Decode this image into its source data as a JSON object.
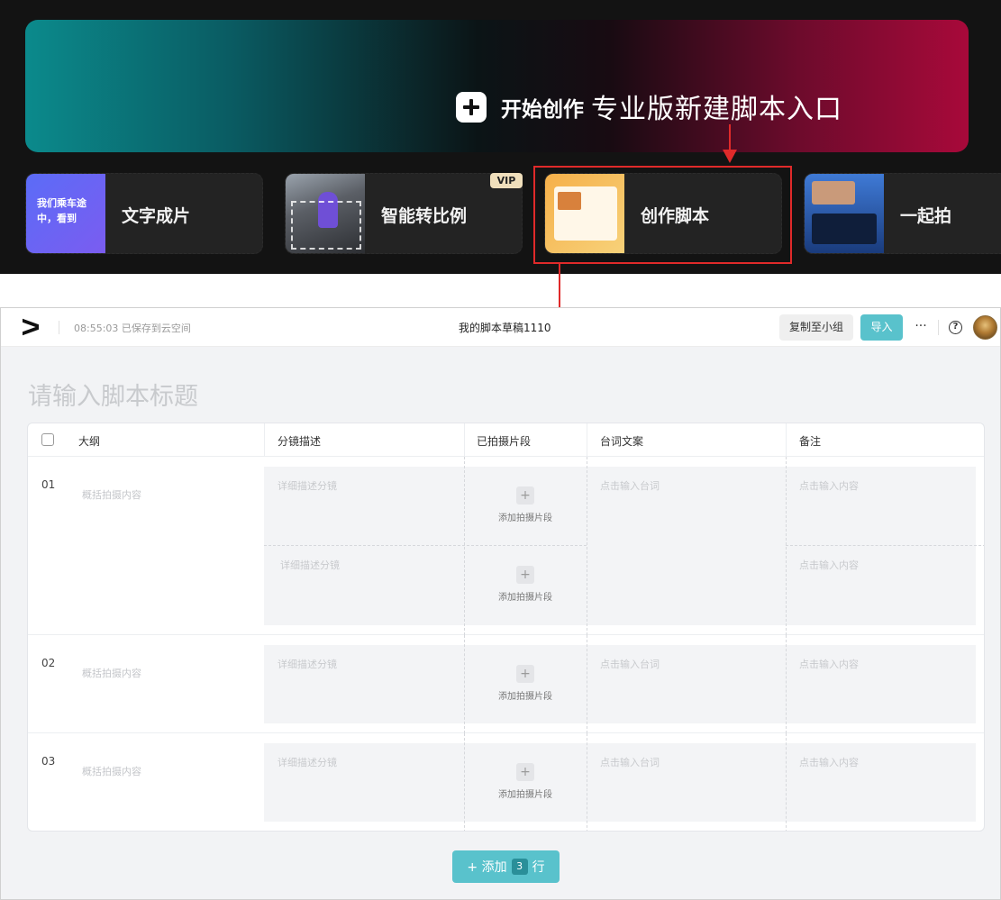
{
  "home": {
    "start_create": "开始创作",
    "annotation": "专业版新建脚本入口",
    "cards": [
      {
        "label": "文字成片",
        "thumb_text": "我们乘车途中，看到"
      },
      {
        "label": "智能转比例",
        "badge": "VIP"
      },
      {
        "label": "创作脚本"
      },
      {
        "label": "一起拍"
      }
    ]
  },
  "editor": {
    "save_status": "08:55:03 已保存到云空间",
    "doc_title": "我的脚本草稿1110",
    "copy_button": "复制至小组",
    "import_button": "导入",
    "more_icon": "···",
    "help_icon": "?",
    "script_title_placeholder": "请输入脚本标题",
    "columns": [
      "大纲",
      "分镜描述",
      "已拍摄片段",
      "台词文案",
      "备注"
    ],
    "rows": [
      {
        "num": "01",
        "outline": "概括拍摄内容"
      },
      {
        "num": "02",
        "outline": "概括拍摄内容"
      },
      {
        "num": "03",
        "outline": "概括拍摄内容"
      }
    ],
    "placeholders": {
      "shot_desc": "详细描述分镜",
      "add_clip": "添加拍摄片段",
      "add_clip_icon": "+",
      "lines": "点击输入台词",
      "notes": "点击输入内容"
    },
    "add_row": {
      "prefix": "+ 添加",
      "count": "3",
      "suffix": "行"
    }
  },
  "colors": {
    "accent": "#59c2cc",
    "annotation_red": "#e02a2a",
    "dark_bg": "#131313"
  }
}
